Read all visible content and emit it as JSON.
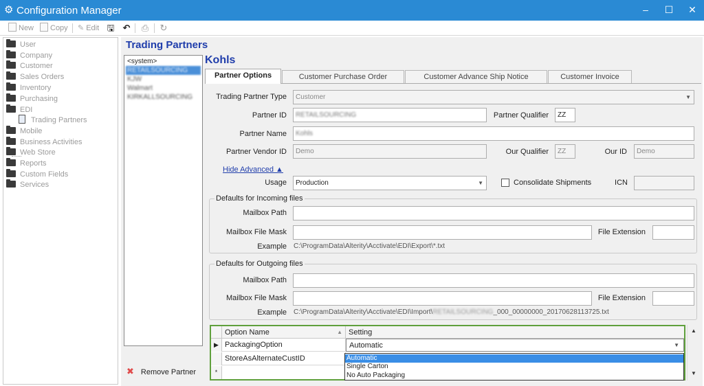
{
  "window": {
    "title": "Configuration Manager",
    "minimize": "–",
    "maximize": "☐",
    "close": "✕"
  },
  "toolbar": {
    "new_label": "New",
    "copy_label": "Copy",
    "edit_label": "Edit"
  },
  "tree": {
    "items": [
      "User",
      "Company",
      "Customer",
      "Sales Orders",
      "Inventory",
      "Purchasing",
      "EDI",
      "Trading Partners",
      "Mobile",
      "Business Activities",
      "Web Store",
      "Reports",
      "Custom Fields",
      "Services"
    ]
  },
  "trading_partners": {
    "heading": "Trading Partners",
    "list": [
      "<system>",
      "RETAILSOURCING",
      "KJW",
      "Walmart",
      "KIRKALLSOURCING"
    ],
    "remove_label": "Remove Partner"
  },
  "partner": {
    "name_heading": "Kohls",
    "tabs": [
      "Partner Options",
      "Customer Purchase Order",
      "Customer Advance Ship Notice",
      "Customer Invoice"
    ],
    "fields": {
      "type_label": "Trading Partner Type",
      "type_value": "Customer",
      "id_label": "Partner ID",
      "id_value": "RETAILSOURCING",
      "qualifier_label": "Partner Qualifier",
      "qualifier_value": "ZZ",
      "name_label": "Partner Name",
      "name_value": "Kohls",
      "vendor_label": "Partner Vendor ID",
      "vendor_value": "Demo",
      "our_qualifier_label": "Our Qualifier",
      "our_qualifier_value": "ZZ",
      "our_id_label": "Our ID",
      "our_id_value": "Demo",
      "hide_advanced": "Hide Advanced ▲",
      "usage_label": "Usage",
      "usage_value": "Production",
      "consolidate_label": "Consolidate Shipments",
      "icn_label": "ICN",
      "icn_value": ""
    },
    "incoming": {
      "title": "Defaults for Incoming files",
      "mailbox_path_label": "Mailbox Path",
      "mailbox_path_value": "",
      "mask_label": "Mailbox File Mask",
      "mask_value": "",
      "ext_label": "File Extension",
      "ext_value": "",
      "example_label": "Example",
      "example_value": "C:\\ProgramData\\Alterity\\Acctivate\\EDI\\Export\\*.txt"
    },
    "outgoing": {
      "title": "Defaults for Outgoing files",
      "mailbox_path_label": "Mailbox Path",
      "mailbox_path_value": "",
      "mask_label": "Mailbox File Mask",
      "mask_value": "",
      "ext_label": "File Extension",
      "ext_value": "",
      "example_label": "Example",
      "example_prefix": "C:\\ProgramData\\Alterity\\Acctivate\\EDI\\Import\\",
      "example_blur": "RETAILSOURCING",
      "example_suffix": "_000_00000000_20170628113725.txt"
    }
  },
  "grid": {
    "headers": [
      "Option Name",
      "Setting"
    ],
    "rows": [
      {
        "indicator": "▶",
        "name": "PackagingOption",
        "setting": "Automatic"
      },
      {
        "indicator": "",
        "name": "StoreAsAlternateCustID",
        "setting": ""
      },
      {
        "indicator": "*",
        "name": "",
        "setting": ""
      }
    ],
    "dropdown_options": [
      "Automatic",
      "Single Carton",
      "No Auto Packaging"
    ]
  }
}
